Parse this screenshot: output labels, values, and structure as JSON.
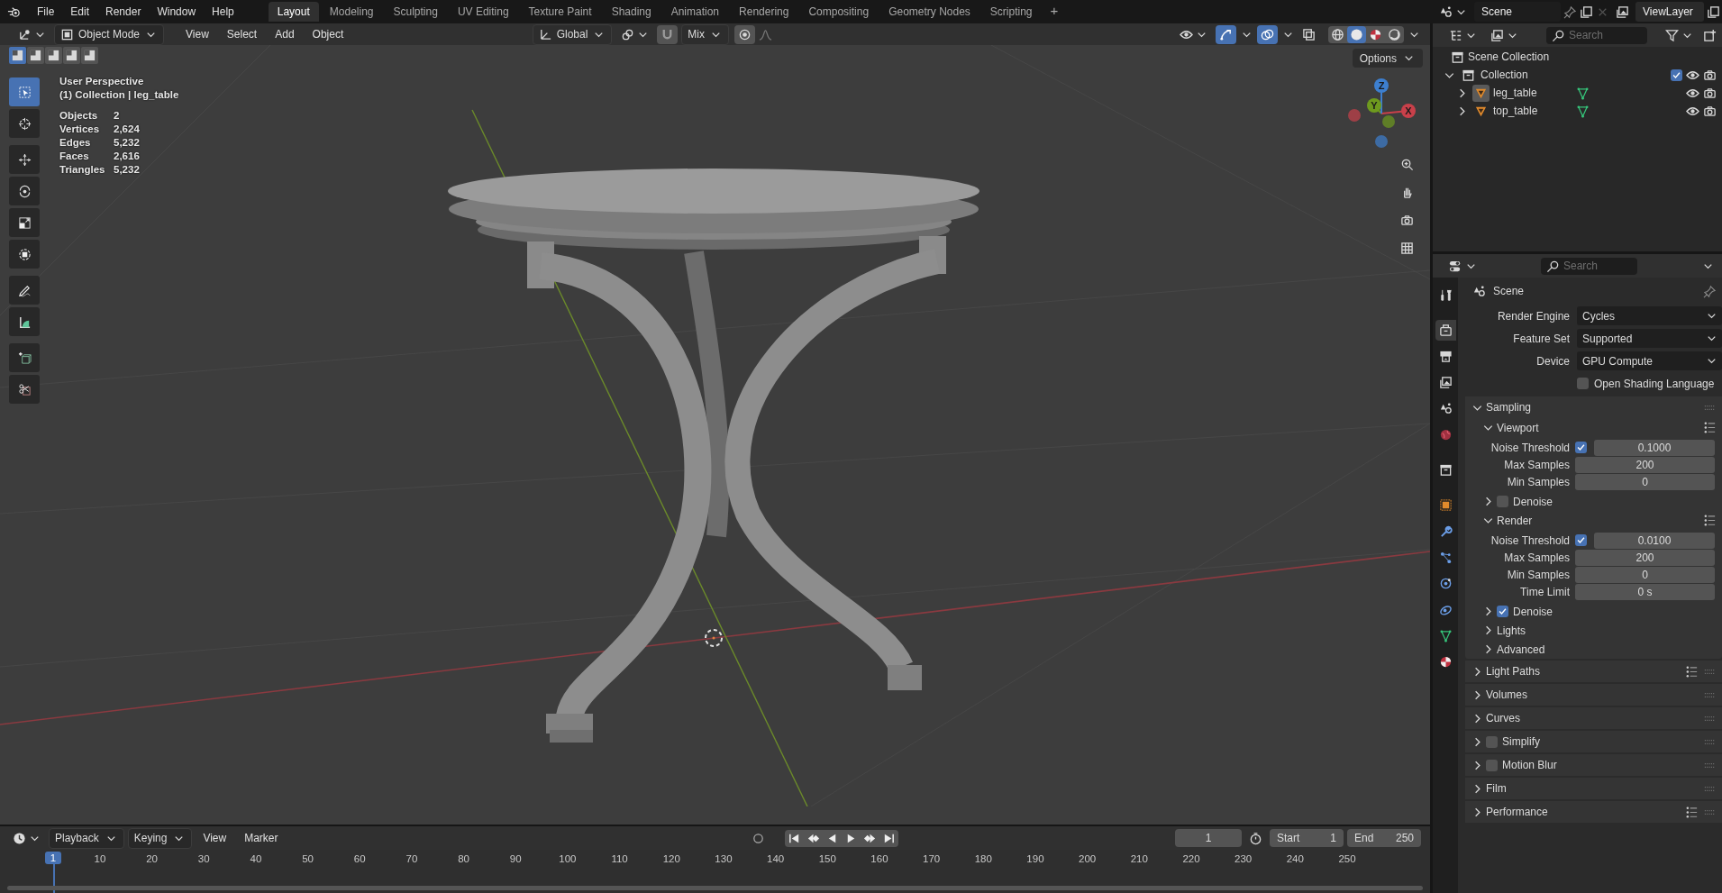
{
  "menu_bar": {
    "menus": [
      "File",
      "Edit",
      "Render",
      "Window",
      "Help"
    ]
  },
  "workspaces": {
    "tabs": [
      {
        "label": "Layout",
        "selected": true
      },
      {
        "label": "Modeling",
        "selected": false
      },
      {
        "label": "Sculpting",
        "selected": false
      },
      {
        "label": "UV Editing",
        "selected": false
      },
      {
        "label": "Texture Paint",
        "selected": false
      },
      {
        "label": "Shading",
        "selected": false
      },
      {
        "label": "Animation",
        "selected": false
      },
      {
        "label": "Rendering",
        "selected": false
      },
      {
        "label": "Compositing",
        "selected": false
      },
      {
        "label": "Geometry Nodes",
        "selected": false
      },
      {
        "label": "Scripting",
        "selected": false
      }
    ],
    "add": "+"
  },
  "scene": {
    "name": "Scene",
    "view_layer": "ViewLayer"
  },
  "viewport": {
    "header": {
      "mode": "Object Mode",
      "menus": [
        "View",
        "Select",
        "Add",
        "Object"
      ],
      "orientation": "Global",
      "snap_target": "Mix",
      "options": "Options",
      "select_modes": [
        {
          "selected": true
        },
        {
          "selected": false
        },
        {
          "selected": false
        },
        {
          "selected": false
        },
        {
          "selected": false
        }
      ],
      "toggles": [
        {
          "kind": "gizmo",
          "on": true
        },
        {
          "kind": "overlay",
          "on": true
        },
        {
          "kind": "xray",
          "on": false
        }
      ],
      "shading": [
        {
          "kind": "wireframe",
          "selected": false
        },
        {
          "kind": "solid",
          "selected": true
        },
        {
          "kind": "material",
          "selected": false
        },
        {
          "kind": "rendered",
          "selected": false
        }
      ]
    },
    "view_name": "User Perspective",
    "context": "(1) Collection | leg_table",
    "stats": [
      {
        "label": "Objects",
        "value": "2"
      },
      {
        "label": "Vertices",
        "value": "2,624"
      },
      {
        "label": "Edges",
        "value": "5,232"
      },
      {
        "label": "Faces",
        "value": "2,616"
      },
      {
        "label": "Triangles",
        "value": "5,232"
      }
    ],
    "tool_groups": [
      [
        {
          "kind": "select_box",
          "selected": true
        },
        {
          "kind": "cursor",
          "selected": false
        }
      ],
      [
        {
          "kind": "move",
          "selected": false
        },
        {
          "kind": "rotate",
          "selected": false
        },
        {
          "kind": "scale",
          "selected": false
        },
        {
          "kind": "transform",
          "selected": false
        }
      ],
      [
        {
          "kind": "annotate",
          "selected": false
        },
        {
          "kind": "measure",
          "selected": false
        }
      ],
      [
        {
          "kind": "add_cube",
          "selected": false
        },
        {
          "kind": "cut",
          "selected": false
        }
      ]
    ],
    "gizmo": [
      {
        "label": "X",
        "color": "#c8404a"
      },
      {
        "label": "Y",
        "color": "#6e9a1e"
      },
      {
        "label": "Z",
        "color": "#3d7fcf"
      }
    ]
  },
  "outliner": {
    "search_placeholder": "Search",
    "root": "Scene Collection",
    "collections": [
      {
        "label": "Collection",
        "expanded": true,
        "checked": true,
        "objects": [
          {
            "label": "leg_table",
            "expanded": false,
            "selected": true
          },
          {
            "label": "top_table",
            "expanded": false,
            "selected": false
          }
        ]
      }
    ]
  },
  "properties": {
    "search_placeholder": "Search",
    "context": "Scene",
    "tabs": [
      {
        "kind": "tool",
        "selected": false
      },
      {
        "kind": "render",
        "selected": true
      },
      {
        "kind": "output",
        "selected": false
      },
      {
        "kind": "view_layer",
        "selected": false
      },
      {
        "kind": "scene",
        "selected": false
      },
      {
        "kind": "world",
        "selected": false
      },
      {
        "kind": "collection",
        "selected": false
      },
      {
        "kind": "object",
        "selected": false
      },
      {
        "kind": "modifiers",
        "selected": false
      },
      {
        "kind": "particles",
        "selected": false
      },
      {
        "kind": "physics",
        "selected": false
      },
      {
        "kind": "constraints",
        "selected": false
      },
      {
        "kind": "data",
        "selected": false
      },
      {
        "kind": "material",
        "selected": false
      }
    ],
    "fields": [
      {
        "label": "Render Engine",
        "value": "Cycles"
      },
      {
        "label": "Feature Set",
        "value": "Supported"
      },
      {
        "label": "Device",
        "value": "GPU Compute"
      }
    ],
    "osl": {
      "label": "Open Shading Language",
      "checked": false
    },
    "panels": [
      {
        "label": "Sampling",
        "expanded": true,
        "presets": false,
        "subpanels": [
          {
            "label": "Viewport",
            "expanded": true,
            "presets": true,
            "rows": [
              {
                "label": "Noise Threshold",
                "checked": true,
                "value": "0.1000"
              },
              {
                "label": "Max Samples",
                "value": "200"
              },
              {
                "label": "Min Samples",
                "value": "0"
              }
            ]
          },
          {
            "label": "Denoise",
            "expanded": false,
            "checked": false
          },
          {
            "label": "Render",
            "expanded": true,
            "presets": true,
            "rows": [
              {
                "label": "Noise Threshold",
                "checked": true,
                "value": "0.0100"
              },
              {
                "label": "Max Samples",
                "value": "200"
              },
              {
                "label": "Min Samples",
                "value": "0"
              },
              {
                "label": "Time Limit",
                "value": "0 s"
              }
            ]
          },
          {
            "label": "Denoise",
            "expanded": false,
            "checked": true
          },
          {
            "label": "Lights",
            "expanded": false
          },
          {
            "label": "Advanced",
            "expanded": false
          }
        ]
      },
      {
        "label": "Light Paths",
        "expanded": false,
        "presets": true
      },
      {
        "label": "Volumes",
        "expanded": false,
        "presets": false
      },
      {
        "label": "Curves",
        "expanded": false,
        "presets": false
      },
      {
        "label": "Simplify",
        "expanded": false,
        "presets": false,
        "checked": false
      },
      {
        "label": "Motion Blur",
        "expanded": false,
        "presets": false,
        "checked": false
      },
      {
        "label": "Film",
        "expanded": false,
        "presets": false
      },
      {
        "label": "Performance",
        "expanded": false,
        "presets": true
      }
    ]
  },
  "timeline": {
    "menus": [
      {
        "label": "Playback",
        "dropdown": true
      },
      {
        "label": "Keying",
        "dropdown": true
      },
      {
        "label": "View",
        "dropdown": false
      },
      {
        "label": "Marker",
        "dropdown": false
      }
    ],
    "current_frame": "1",
    "start_label": "Start",
    "start": "1",
    "end_label": "End",
    "end": "250",
    "playhead": "1",
    "ruler": [
      "10",
      "20",
      "30",
      "40",
      "50",
      "60",
      "70",
      "80",
      "90",
      "100",
      "110",
      "120",
      "130",
      "140",
      "150",
      "160",
      "170",
      "180",
      "190",
      "200",
      "210",
      "220",
      "230",
      "240",
      "250"
    ]
  }
}
